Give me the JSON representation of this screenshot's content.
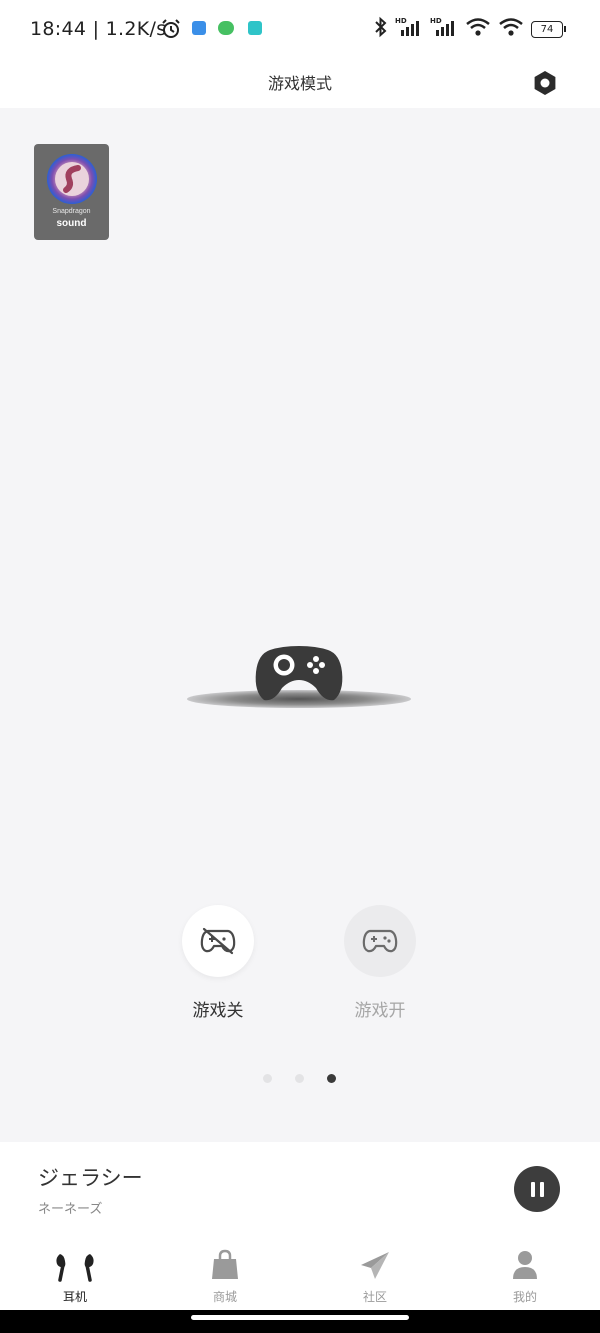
{
  "status": {
    "time": "18:44",
    "speed": "1.2K/s",
    "battery": "74"
  },
  "header": {
    "title": "游戏模式"
  },
  "badge": {
    "brand_line1": "Snapdragon",
    "brand_line2": "sound"
  },
  "modes": [
    {
      "label": "游戏关",
      "selected": true
    },
    {
      "label": "游戏开",
      "selected": false
    }
  ],
  "pager": {
    "count": 3,
    "active_index": 2
  },
  "now_playing": {
    "title": "ジェラシー",
    "artist": "ネーネーズ",
    "state": "playing"
  },
  "nav": {
    "items": [
      {
        "label": "耳机",
        "icon": "earbuds-icon",
        "active": true
      },
      {
        "label": "商城",
        "icon": "shopping-bag-icon",
        "active": false
      },
      {
        "label": "社区",
        "icon": "paper-plane-icon",
        "active": false
      },
      {
        "label": "我的",
        "icon": "person-icon",
        "active": false
      }
    ]
  },
  "colors": {
    "background": "#f5f5f7",
    "active": "#222222",
    "inactive": "#9a9a9a",
    "controller": "#3a3a3a"
  }
}
